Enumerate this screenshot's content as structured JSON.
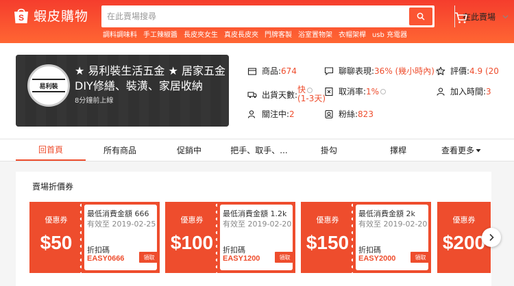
{
  "header": {
    "logo_text": "蝦皮購物",
    "search_placeholder": "在此賣場搜尋",
    "search_scope": "在此賣場",
    "hotwords": [
      "調料調味料",
      "手工辣椒醬",
      "長皮夾女生",
      "真皮長皮夾",
      "門牌客製",
      "浴室置物架",
      "衣帽架桿",
      "usb 充電器"
    ]
  },
  "shop": {
    "name": "★ 易利裝生活五金 ★ 居家五金DIY修繕、裝潢、家居收納",
    "avatar_text": "易利裝",
    "online_status": "8分鐘前上線",
    "stats": {
      "products_label": "商品: ",
      "products_value": "674",
      "chat_label": "聊聊表現: ",
      "chat_value": "36% (幾小時內)",
      "rating_label": "評價: ",
      "rating_value": "4.9 (20",
      "ship_label": "出貨天數: ",
      "ship_value_1": "快",
      "ship_value_2": "(1-3天)",
      "cancel_label": "取消率: ",
      "cancel_value": "1%",
      "joined_label": "加入時間: ",
      "joined_value": "3",
      "following_label": "關注中: ",
      "following_value": "2",
      "followers_label": "粉絲: ",
      "followers_value": "823"
    }
  },
  "nav": {
    "items": [
      "回首頁",
      "所有商品",
      "促銷中",
      "把手、取手、...",
      "掛勾",
      "擇桿"
    ],
    "more": "查看更多"
  },
  "coupons": {
    "title": "賣場折價券",
    "items": [
      {
        "kind": "優惠券",
        "amount": "$50",
        "min": "最低消費金額 666",
        "expiry": "有效至 2019-02-25",
        "code_label": "折扣碼",
        "code": "EASY0666",
        "button": "領取"
      },
      {
        "kind": "優惠券",
        "amount": "$100",
        "min": "最低消費金額 1.2k",
        "expiry": "有效至 2019-02-20",
        "code_label": "折扣碼",
        "code": "EASY1200",
        "button": "領取"
      },
      {
        "kind": "優惠券",
        "amount": "$150",
        "min": "最低消費金額 2k",
        "expiry": "有效至 2019-02-20",
        "code_label": "折扣碼",
        "code": "EASY2000",
        "button": "領取"
      },
      {
        "kind": "優惠券",
        "amount": "$200"
      }
    ]
  },
  "colors": {
    "brand": "#ee4d2d",
    "header_start": "#f53d2d",
    "header_end": "#ff6633"
  }
}
